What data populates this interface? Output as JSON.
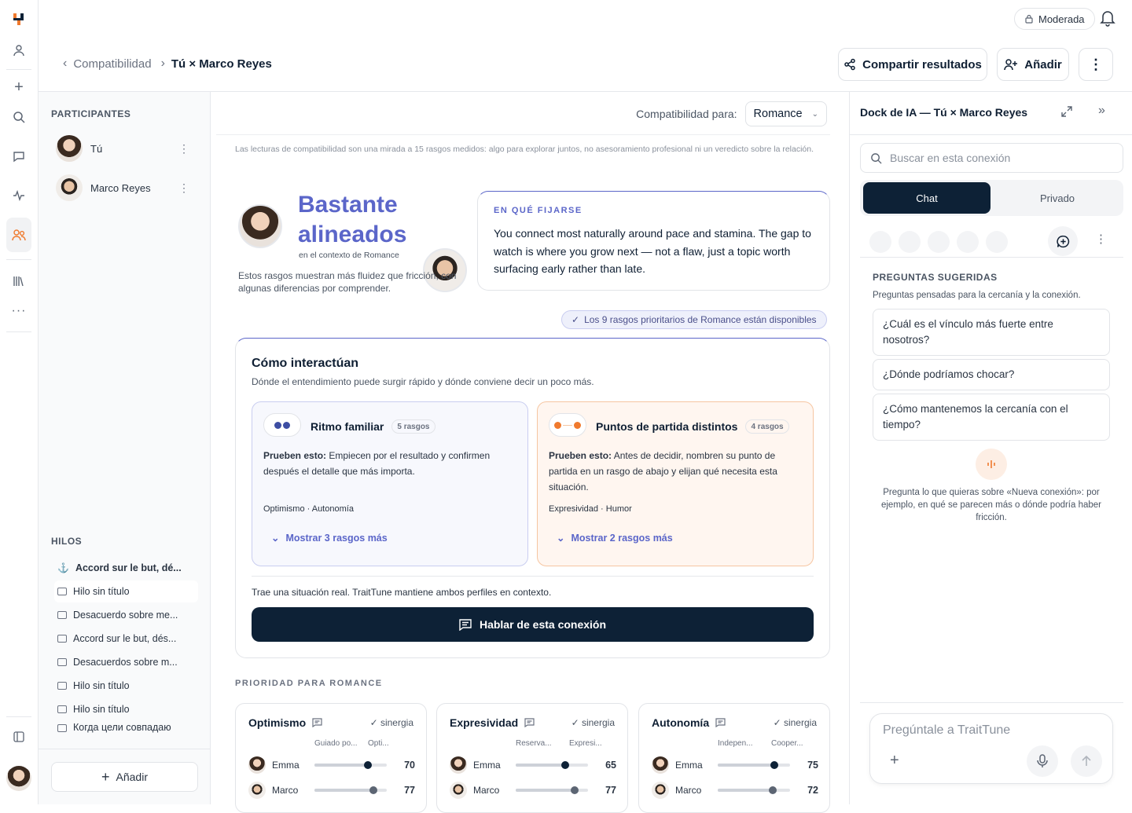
{
  "header": {
    "mode_badge": "Moderada",
    "breadcrumb_parent": "Compatibilidad",
    "breadcrumb_current": "Tú × Marco Reyes",
    "share_label": "Compartir resultados",
    "add_label": "Añadir"
  },
  "left": {
    "participants_title": "PARTICIPANTES",
    "participants": [
      {
        "name": "Tú"
      },
      {
        "name": "Marco Reyes"
      }
    ],
    "threads_title": "HILOS",
    "threads": [
      {
        "label": "Accord sur le but, dé..."
      },
      {
        "label": "Hilo sin título"
      },
      {
        "label": "Desacuerdo sobre me..."
      },
      {
        "label": "Accord sur le but, dés..."
      },
      {
        "label": "Desacuerdos sobre m..."
      },
      {
        "label": "Hilo sin título"
      },
      {
        "label": "Hilo sin título"
      },
      {
        "label": "Когда цели совпадаю"
      }
    ],
    "add_label": "Añadir"
  },
  "main": {
    "context_label": "Compatibilidad para:",
    "context_value": "Romance",
    "disclaimer": "Las lecturas de compatibilidad son una mirada a 15 rasgos medidos: algo para explorar juntos, no asesoramiento profesional ni un veredicto sobre la relación.",
    "verdict_line1": "Bastante",
    "verdict_line2": "alineados",
    "verdict_context": "en el contexto de Romance",
    "verdict_desc": "Estos rasgos muestran más fluidez que fricción, con algunas diferencias por comprender.",
    "focus_title": "EN QUÉ FIJARSE",
    "focus_text": "You connect most naturally around pace and stamina. The gap to watch is where you grow next — not a flaw, just a topic worth surfacing early rather than late.",
    "availability": "Los 9 rasgos prioritarios de Romance están disponibles",
    "interact_title": "Cómo interactúan",
    "interact_subtitle": "Dónde el entendimiento puede surgir rápido y dónde conviene decir un poco más.",
    "rhythm": {
      "title": "Ritmo familiar",
      "count": "5 rasgos",
      "try_label": "Prueben esto:",
      "try_text": "Empiecen por el resultado y confirmen después el detalle que más importa.",
      "traits": "Optimismo · Autonomía",
      "more": "Mostrar 3 rasgos más"
    },
    "starts": {
      "title": "Puntos de partida distintos",
      "count": "4 rasgos",
      "try_label": "Prueben esto:",
      "try_text": "Antes de decidir, nombren su punto de partida en un rasgo de abajo y elijan qué necesita esta situación.",
      "traits": "Expresividad · Humor",
      "more": "Mostrar 2 rasgos más"
    },
    "real_situation": "Trae una situación real. TraitTune mantiene ambos perfiles en contexto.",
    "cta": "Hablar de esta conexión",
    "priority_title": "PRIORIDAD PARA ROMANCE",
    "priority": [
      {
        "name": "Optimismo",
        "syn": "sinergia",
        "pole_l": "Guiado po...",
        "pole_r": "Opti...",
        "rows": [
          {
            "who": "Emma",
            "val": "70",
            "frac": 0.74
          },
          {
            "who": "Marco",
            "val": "77",
            "frac": 0.82
          }
        ]
      },
      {
        "name": "Expresividad",
        "syn": "sinergia",
        "pole_l": "Reserva...",
        "pole_r": "Expresi...",
        "rows": [
          {
            "who": "Emma",
            "val": "65",
            "frac": 0.68
          },
          {
            "who": "Marco",
            "val": "77",
            "frac": 0.82
          }
        ]
      },
      {
        "name": "Autonomía",
        "syn": "sinergia",
        "pole_l": "Indepen...",
        "pole_r": "Cooper...",
        "rows": [
          {
            "who": "Emma",
            "val": "75",
            "frac": 0.78
          },
          {
            "who": "Marco",
            "val": "72",
            "frac": 0.76
          }
        ]
      }
    ]
  },
  "dock": {
    "title": "Dock de IA — Tú × Marco Reyes",
    "search_placeholder": "Buscar en esta conexión",
    "tab_chat": "Chat",
    "tab_private": "Privado",
    "suggested_title": "PREGUNTAS SUGERIDAS",
    "suggested_sub": "Preguntas pensadas para la cercanía y la conexión.",
    "questions": [
      "¿Cuál es el vínculo más fuerte entre nosotros?",
      "¿Dónde podríamos chocar?",
      "¿Cómo mantenemos la cercanía con el tiempo?"
    ],
    "hint": "Pregunta lo que quieras sobre «Nueva conexión»: por ejemplo, en qué se parecen más o dónde podría haber fricción.",
    "input_placeholder": "Pregúntale a TraitTune"
  },
  "colors": {
    "accent": "#5b66c9",
    "navy": "#0d2136",
    "orange": "#f07a2e",
    "blue_dot": "#3d4ea3"
  }
}
